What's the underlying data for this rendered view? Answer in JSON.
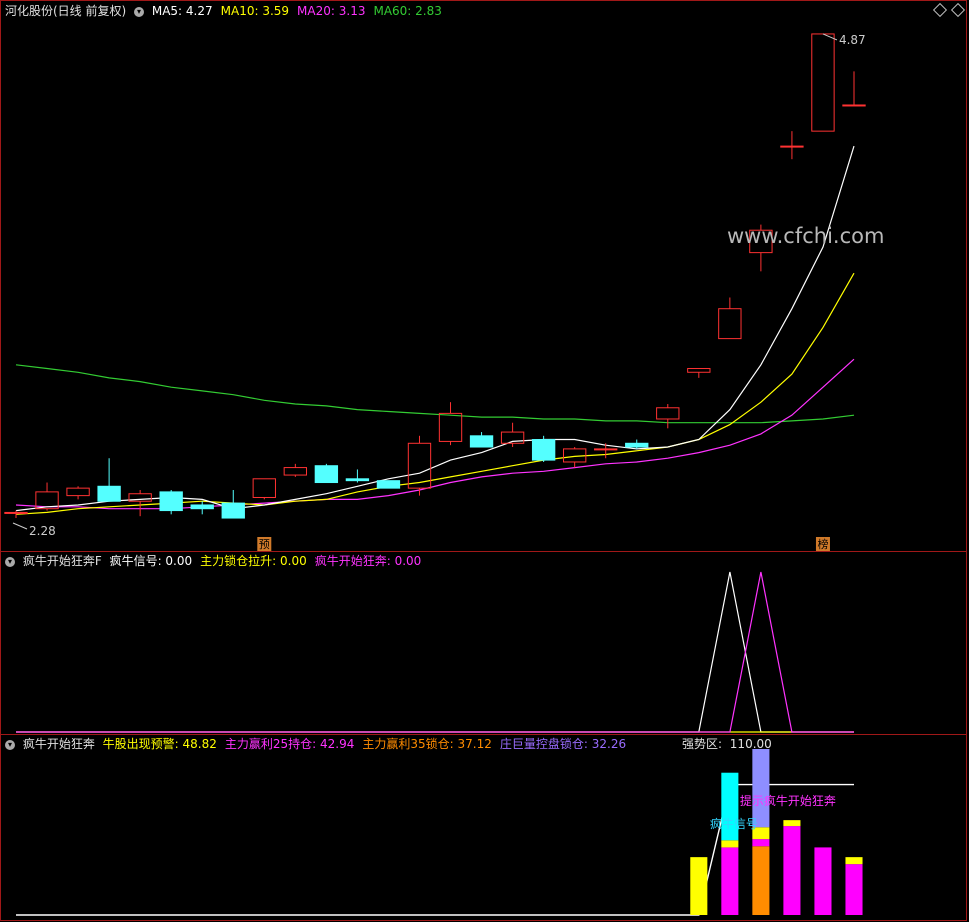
{
  "panel1": {
    "title": "河化股份(日线 前复权)",
    "indicators": [
      {
        "label": "MA5: ",
        "value": "4.27",
        "color": "#ffffff"
      },
      {
        "label": "MA10: ",
        "value": "3.59",
        "color": "#ffff00"
      },
      {
        "label": "MA20: ",
        "value": "3.13",
        "color": "#ff33ff"
      },
      {
        "label": "MA60: ",
        "value": "2.83",
        "color": "#33cc33"
      }
    ],
    "high_label": "4.87",
    "low_label": "2.28",
    "watermark": "www.cfchi.com",
    "markers": [
      "预",
      "榜"
    ]
  },
  "panel2": {
    "title": "疯牛开始狂奔F",
    "indicators": [
      {
        "label": "疯牛信号: ",
        "value": "0.00",
        "color": "#ffffff"
      },
      {
        "label": "主力锁仓拉升: ",
        "value": "0.00",
        "color": "#ffff00"
      },
      {
        "label": "疯牛开始狂奔: ",
        "value": "0.00",
        "color": "#ff33ff"
      }
    ]
  },
  "panel3": {
    "title": "疯牛开始狂奔",
    "indicators": [
      {
        "label": "牛股出现预警: ",
        "value": "48.82",
        "color": "#ffff00"
      },
      {
        "label": "主力赢利25持仓: ",
        "value": "42.94",
        "color": "#ff33ff"
      },
      {
        "label": "主力赢利35锁仓: ",
        "value": "37.12",
        "color": "#ff8c00"
      },
      {
        "label": "庄巨量控盘锁仓: ",
        "value": "32.26",
        "color": "#9a6cff"
      }
    ],
    "strong_zone": {
      "label": "强势区: ",
      "value": "110.00"
    },
    "annotations": {
      "signal": "疯牛信号",
      "prompt": "提示疯牛开始狂奔"
    }
  },
  "chart_data": [
    {
      "type": "candlestick",
      "title": "河化股份(日线 前复权)",
      "colors": {
        "up": "#ff3232",
        "down": "#54ffff",
        "ma5": "#ffffff",
        "ma10": "#ffff00",
        "ma20": "#ff33ff",
        "ma60": "#33cc33"
      },
      "ylim": [
        2.2,
        4.95
      ],
      "candles": [
        {
          "o": 2.31,
          "h": 2.32,
          "l": 2.28,
          "c": 2.31
        },
        {
          "o": 2.33,
          "h": 2.47,
          "l": 2.32,
          "c": 2.42
        },
        {
          "o": 2.4,
          "h": 2.45,
          "l": 2.38,
          "c": 2.44
        },
        {
          "o": 2.45,
          "h": 2.6,
          "l": 2.38,
          "c": 2.37
        },
        {
          "o": 2.37,
          "h": 2.43,
          "l": 2.29,
          "c": 2.41
        },
        {
          "o": 2.42,
          "h": 2.43,
          "l": 2.3,
          "c": 2.32
        },
        {
          "o": 2.35,
          "h": 2.37,
          "l": 2.3,
          "c": 2.33
        },
        {
          "o": 2.36,
          "h": 2.43,
          "l": 2.31,
          "c": 2.28
        },
        {
          "o": 2.39,
          "h": 2.49,
          "l": 2.38,
          "c": 2.49
        },
        {
          "o": 2.51,
          "h": 2.57,
          "l": 2.5,
          "c": 2.55
        },
        {
          "o": 2.56,
          "h": 2.57,
          "l": 2.47,
          "c": 2.47
        },
        {
          "o": 2.49,
          "h": 2.54,
          "l": 2.47,
          "c": 2.48
        },
        {
          "o": 2.48,
          "h": 2.48,
          "l": 2.44,
          "c": 2.44
        },
        {
          "o": 2.44,
          "h": 2.72,
          "l": 2.4,
          "c": 2.68
        },
        {
          "o": 2.69,
          "h": 2.9,
          "l": 2.67,
          "c": 2.84
        },
        {
          "o": 2.72,
          "h": 2.74,
          "l": 2.66,
          "c": 2.66
        },
        {
          "o": 2.68,
          "h": 2.79,
          "l": 2.66,
          "c": 2.74
        },
        {
          "o": 2.7,
          "h": 2.72,
          "l": 2.58,
          "c": 2.59
        },
        {
          "o": 2.58,
          "h": 2.66,
          "l": 2.55,
          "c": 2.65
        },
        {
          "o": 2.65,
          "h": 2.68,
          "l": 2.6,
          "c": 2.65
        },
        {
          "o": 2.68,
          "h": 2.7,
          "l": 2.65,
          "c": 2.66
        },
        {
          "o": 2.81,
          "h": 2.89,
          "l": 2.76,
          "c": 2.87
        },
        {
          "o": 3.06,
          "h": 3.08,
          "l": 3.03,
          "c": 3.08
        },
        {
          "o": 3.24,
          "h": 3.46,
          "l": 3.24,
          "c": 3.4
        },
        {
          "o": 3.7,
          "h": 3.85,
          "l": 3.6,
          "c": 3.82
        },
        {
          "o": 4.27,
          "h": 4.35,
          "l": 4.2,
          "c": 4.27
        },
        {
          "o": 4.35,
          "h": 4.87,
          "l": 4.35,
          "c": 4.87
        },
        {
          "o": 4.49,
          "h": 4.67,
          "l": 4.49,
          "c": 4.49
        }
      ],
      "ma5": [
        2.32,
        2.34,
        2.35,
        2.37,
        2.38,
        2.39,
        2.38,
        2.33,
        2.35,
        2.38,
        2.41,
        2.45,
        2.49,
        2.52,
        2.59,
        2.63,
        2.69,
        2.7,
        2.7,
        2.67,
        2.65,
        2.66,
        2.7,
        2.86,
        3.1,
        3.4,
        3.73,
        4.27
      ],
      "ma10": [
        2.3,
        2.31,
        2.33,
        2.34,
        2.35,
        2.36,
        2.37,
        2.36,
        2.35,
        2.37,
        2.38,
        2.42,
        2.45,
        2.47,
        2.5,
        2.53,
        2.56,
        2.59,
        2.61,
        2.62,
        2.64,
        2.66,
        2.7,
        2.78,
        2.9,
        3.05,
        3.3,
        3.59
      ],
      "ma20": [
        2.35,
        2.34,
        2.34,
        2.33,
        2.33,
        2.33,
        2.34,
        2.35,
        2.36,
        2.37,
        2.38,
        2.38,
        2.4,
        2.43,
        2.47,
        2.5,
        2.52,
        2.53,
        2.55,
        2.57,
        2.58,
        2.6,
        2.63,
        2.67,
        2.73,
        2.83,
        2.98,
        3.13
      ],
      "ma60": [
        3.1,
        3.08,
        3.06,
        3.03,
        3.01,
        2.98,
        2.96,
        2.94,
        2.91,
        2.89,
        2.88,
        2.86,
        2.85,
        2.84,
        2.83,
        2.82,
        2.82,
        2.81,
        2.81,
        2.8,
        2.8,
        2.79,
        2.79,
        2.79,
        2.79,
        2.8,
        2.81,
        2.83
      ]
    },
    {
      "type": "line",
      "title": "疯牛开始狂奔F",
      "series": [
        {
          "name": "疯牛信号",
          "color": "#ffffff",
          "values": [
            0,
            0,
            0,
            0,
            0,
            0,
            0,
            0,
            0,
            0,
            0,
            0,
            0,
            0,
            0,
            0,
            0,
            0,
            0,
            0,
            0,
            0,
            0,
            1,
            0,
            0,
            0,
            0
          ]
        },
        {
          "name": "主力锁仓拉升",
          "color": "#ffff00",
          "values": [
            0,
            0,
            0,
            0,
            0,
            0,
            0,
            0,
            0,
            0,
            0,
            0,
            0,
            0,
            0,
            0,
            0,
            0,
            0,
            0,
            0,
            0,
            0,
            0,
            0,
            0,
            0,
            0
          ]
        },
        {
          "name": "疯牛开始狂奔",
          "color": "#ff33ff",
          "values": [
            0,
            0,
            0,
            0,
            0,
            0,
            0,
            0,
            0,
            0,
            0,
            0,
            0,
            0,
            0,
            0,
            0,
            0,
            0,
            0,
            0,
            0,
            0,
            0,
            1,
            0,
            0,
            0
          ]
        }
      ]
    },
    {
      "type": "bar",
      "title": "疯牛开始狂奔",
      "ylim": [
        0,
        140
      ],
      "strong_zone_line": [
        0,
        0,
        0,
        0,
        0,
        0,
        0,
        0,
        0,
        0,
        0,
        0,
        0,
        0,
        0,
        0,
        0,
        0,
        0,
        0,
        0,
        0,
        0,
        110,
        110,
        110,
        110,
        110
      ],
      "bars": [
        {
          "i": 22,
          "segments": [
            {
              "color": "#ffff00",
              "v": 48.8
            }
          ]
        },
        {
          "i": 23,
          "segments": [
            {
              "color": "#ff00ff",
              "v": 57
            },
            {
              "color": "#ffff00",
              "v": 6
            },
            {
              "color": "#00ffff",
              "v": 57
            }
          ]
        },
        {
          "i": 24,
          "segments": [
            {
              "color": "#ff8c00",
              "v": 58
            },
            {
              "color": "#ff00ff",
              "v": 6
            },
            {
              "color": "#ffff00",
              "v": 10
            },
            {
              "color": "#8e8eff",
              "v": 66
            }
          ]
        },
        {
          "i": 25,
          "segments": [
            {
              "color": "#ff00ff",
              "v": 75
            },
            {
              "color": "#ffff00",
              "v": 5
            }
          ]
        },
        {
          "i": 26,
          "segments": [
            {
              "color": "#ff00ff",
              "v": 57
            }
          ]
        },
        {
          "i": 27,
          "segments": [
            {
              "color": "#ff00ff",
              "v": 42.9
            },
            {
              "color": "#ffff00",
              "v": 5.9
            }
          ]
        }
      ]
    }
  ]
}
